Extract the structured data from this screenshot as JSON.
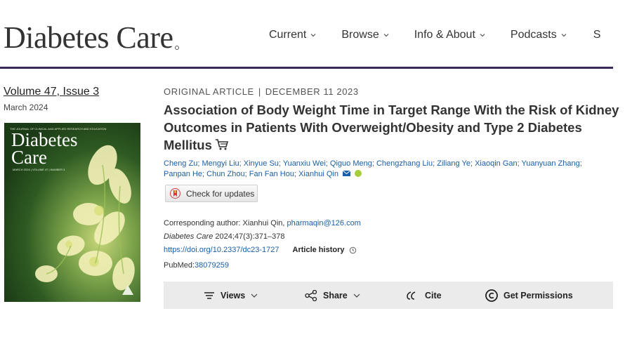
{
  "header": {
    "logo": "Diabetes Care",
    "nav": [
      {
        "label": "Current",
        "has_dropdown": true
      },
      {
        "label": "Browse",
        "has_dropdown": true
      },
      {
        "label": "Info & About",
        "has_dropdown": true
      },
      {
        "label": "Podcasts",
        "has_dropdown": true
      },
      {
        "label": "S",
        "has_dropdown": false
      }
    ],
    "rule_color": "#3a2a5c"
  },
  "issue": {
    "volume_link": "Volume 47, Issue 3",
    "date": "March 2024",
    "cover": {
      "top_line": "THE JOURNAL OF CLINICAL AND APPLIED RESEARCH AND EDUCATION",
      "title_line1": "Diabetes",
      "title_line2": "Care",
      "meta": "MARCH 2024 | VOLUME 47 | NUMBER 3"
    }
  },
  "article": {
    "type": "ORIGINAL ARTICLE",
    "separator": "|",
    "date": "DECEMBER 11 2023",
    "title": "Association of Body Weight Time in Target Range With the Risk of Kidney Outcomes in Patients With Overweight/Obesity and Type 2 Diabetes Mellitus",
    "authors": [
      "Cheng Zu",
      "Mengyi Liu",
      "Xinyue Su",
      "Yuanxiu Wei",
      "Qiguo Meng",
      "Chengzhang Liu",
      "Ziliang Ye",
      "Xiaoqin Gan",
      "Yuanyuan Zhang",
      "Panpan He",
      "Chun Zhou",
      "Fan Fan Hou",
      "Xianhui Qin"
    ],
    "check_updates_label": "Check for updates",
    "corresponding_label": "Corresponding author: Xianhui Qin,",
    "corresponding_email": "pharmaqin@126.com",
    "citation_journal": "Diabetes Care",
    "citation_detail": "2024;47(3):371–378",
    "doi": "https://doi.org/10.2337/dc23-1727",
    "article_history_label": "Article history",
    "pubmed_label": "PubMed:",
    "pubmed_id": "38079259"
  },
  "toolbar": {
    "views_label": "Views",
    "share_label": "Share",
    "cite_label": "Cite",
    "permissions_label": "Get Permissions"
  },
  "colors": {
    "link": "#1a5fa8",
    "orcid": "#a6ce39",
    "toolbar_bg": "#ebebeb"
  },
  "icons": [
    "chevron-down-icon",
    "cart-icon",
    "mail-icon",
    "orcid-icon",
    "crossmark-icon",
    "history-icon",
    "menu-lines-icon",
    "share-icon",
    "quote-icon",
    "copyright-icon"
  ]
}
